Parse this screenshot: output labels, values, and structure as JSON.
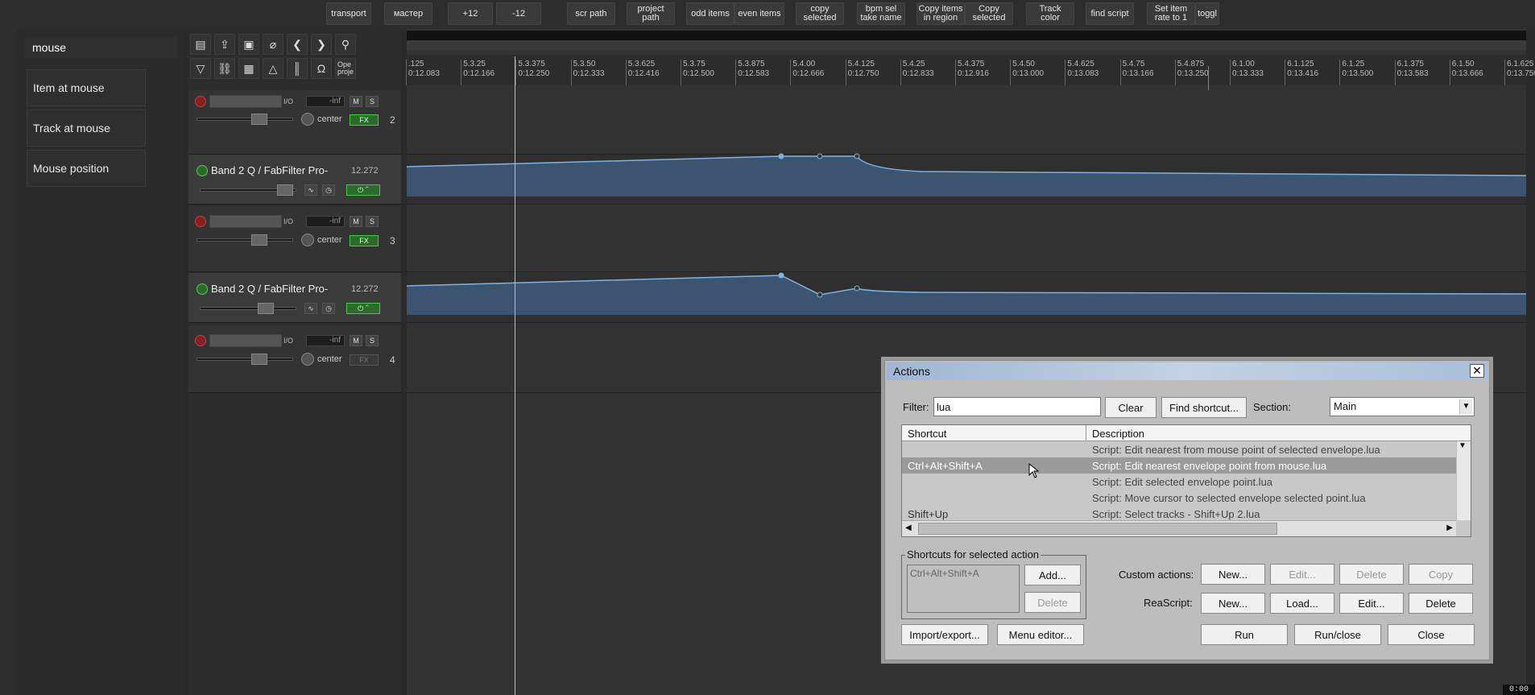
{
  "toolbar": {
    "buttons": [
      {
        "label": "transport"
      },
      {
        "label": "мастер"
      },
      {
        "label": "+12"
      },
      {
        "label": "-12"
      },
      {
        "label": "scr path"
      },
      {
        "label": "project\npath"
      },
      {
        "label": "odd items"
      },
      {
        "label": "even items"
      },
      {
        "label": "copy\nselected"
      },
      {
        "label": "bpm sel\ntake name"
      },
      {
        "label": "Copy items\nin region"
      },
      {
        "label": "Copy\nselected"
      },
      {
        "label": "Track\ncolor"
      },
      {
        "label": "find script"
      },
      {
        "label": "Set item\nrate to 1"
      },
      {
        "label": "toggl"
      }
    ]
  },
  "search": {
    "value": "mouse",
    "items": [
      "Item at mouse",
      "Track at mouse",
      "Mouse position"
    ]
  },
  "tools": {
    "open_project_label": "Ope\nproje"
  },
  "tracks": [
    {
      "number": "2",
      "volume": "-inf",
      "io": "I/O",
      "pan": "center",
      "mute": "M",
      "solo": "S",
      "fx": "FX"
    },
    {
      "number": "3",
      "volume": "-inf",
      "io": "I/O",
      "pan": "center",
      "mute": "M",
      "solo": "S",
      "fx": "FX"
    },
    {
      "number": "4",
      "volume": "-inf",
      "io": "I/O",
      "pan": "center",
      "mute": "M",
      "solo": "S",
      "fx": "FX"
    }
  ],
  "envelopes": [
    {
      "name": "Band 2 Q / FabFilter Pro-",
      "value": "12.272"
    },
    {
      "name": "Band 2 Q / FabFilter Pro-",
      "value": "12.272"
    }
  ],
  "ruler": {
    "ticks": [
      {
        "beat": ".125",
        "time": "0:12.083"
      },
      {
        "beat": "5.3.25",
        "time": "0:12.166"
      },
      {
        "beat": "5.3.375",
        "time": "0:12.250"
      },
      {
        "beat": "5.3.50",
        "time": "0:12.333"
      },
      {
        "beat": "5.3.625",
        "time": "0:12.416"
      },
      {
        "beat": "5.3.75",
        "time": "0:12.500"
      },
      {
        "beat": "5.3.875",
        "time": "0:12.583"
      },
      {
        "beat": "5.4.00",
        "time": "0:12.666"
      },
      {
        "beat": "5.4.125",
        "time": "0:12.750"
      },
      {
        "beat": "5.4.25",
        "time": "0:12.833"
      },
      {
        "beat": "5.4.375",
        "time": "0:12.916"
      },
      {
        "beat": "5.4.50",
        "time": "0:13.000"
      },
      {
        "beat": "5.4.625",
        "time": "0:13.083"
      },
      {
        "beat": "5.4.75",
        "time": "0:13.166"
      },
      {
        "beat": "5.4.875",
        "time": "0:13.250"
      },
      {
        "beat": "6.1.00",
        "time": "0:13.333"
      },
      {
        "beat": "6.1.125",
        "time": "0:13.416"
      },
      {
        "beat": "6.1.25",
        "time": "0:13.500"
      },
      {
        "beat": "6.1.375",
        "time": "0:13.583"
      },
      {
        "beat": "6.1.50",
        "time": "0:13.666"
      },
      {
        "beat": "6.1.625",
        "time": "0:13.750"
      }
    ]
  },
  "dialog": {
    "title": "Actions",
    "close": "✕",
    "filter_label": "Filter:",
    "filter_value": "lua",
    "clear": "Clear",
    "find_shortcut": "Find shortcut...",
    "section_label": "Section:",
    "section_value": "Main",
    "col_shortcut": "Shortcut",
    "col_description": "Description",
    "rows": [
      {
        "shortcut": "",
        "description": "Script: Edit nearest from mouse point of selected envelope.lua"
      },
      {
        "shortcut": "Ctrl+Alt+Shift+A",
        "description": "Script: Edit nearest envelope point from mouse.lua"
      },
      {
        "shortcut": "",
        "description": "Script: Edit selected envelope point.lua"
      },
      {
        "shortcut": "",
        "description": "Script: Move cursor to selected envelope selected point.lua"
      },
      {
        "shortcut": "Shift+Up",
        "description": "Script: Select tracks - Shift+Up 2.lua"
      }
    ],
    "shortcuts_group": "Shortcuts for selected action",
    "selected_shortcut": "Ctrl+Alt+Shift+A",
    "add": "Add...",
    "delete_shortcut": "Delete",
    "custom_actions_label": "Custom actions:",
    "reascript_label": "ReaScript:",
    "custom_new": "New...",
    "custom_edit": "Edit...",
    "custom_delete": "Delete",
    "custom_copy": "Copy",
    "rs_new": "New...",
    "rs_load": "Load...",
    "rs_edit": "Edit...",
    "rs_delete": "Delete",
    "import_export": "Import/export...",
    "menu_editor": "Menu editor...",
    "run": "Run",
    "run_close": "Run/close",
    "close_btn": "Close"
  },
  "status": {
    "corner": "0:00"
  },
  "colors": {
    "envelope": "#7fb2e5",
    "envelope_fill": "#3c5470",
    "accent": "#2d6b2d"
  }
}
